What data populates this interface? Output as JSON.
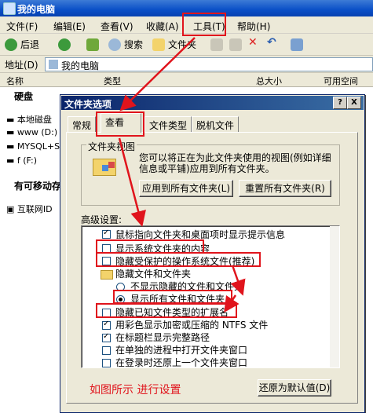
{
  "window": {
    "title": "我的电脑"
  },
  "menu": [
    "文件(F)",
    "编辑(E)",
    "查看(V)",
    "收藏(A)",
    "工具(T)",
    "帮助(H)"
  ],
  "toolbar": {
    "back": "后退",
    "search": "搜索",
    "folders": "文件夹"
  },
  "address": {
    "label": "地址(D)",
    "value": "我的电脑"
  },
  "columns": {
    "name": "名称",
    "type": "类型",
    "total": "总大小",
    "free": "可用空间"
  },
  "groups": {
    "hdd": "硬盘",
    "removable": "有可移动存"
  },
  "drives": [
    "本地磁盘",
    "www (D:)",
    "MYSQL+SQL",
    "f (F:)",
    "互联网ID"
  ],
  "dialog": {
    "title": "文件夹选项",
    "help": "?",
    "close": "X",
    "tabs": [
      "常规",
      "查看",
      "文件类型",
      "脱机文件"
    ],
    "view_group_title": "文件夹视图",
    "view_desc": "您可以将正在为此文件夹使用的视图(例如详细信息或平铺)应用到所有文件夹。",
    "apply_all": "应用到所有文件夹(L)",
    "reset_all": "重置所有文件夹(R)",
    "advanced_label": "高级设置:",
    "options": [
      "鼠标指向文件夹和桌面项时显示提示信息",
      "显示系统文件夹的内容",
      "隐藏受保护的操作系统文件(推荐)",
      "隐藏文件和文件夹",
      "不显示隐藏的文件和文件夹",
      "显示所有文件和文件夹",
      "隐藏已知文件类型的扩展名",
      "用彩色显示加密或压缩的 NTFS 文件",
      "在标题栏显示完整路径",
      "在单独的进程中打开文件夹窗口",
      "在登录时还原上一个文件夹窗口"
    ],
    "restore_defaults": "还原为默认值(D)",
    "annotation": "如图所示 进行设置"
  },
  "highlight_color": "#e0141c"
}
